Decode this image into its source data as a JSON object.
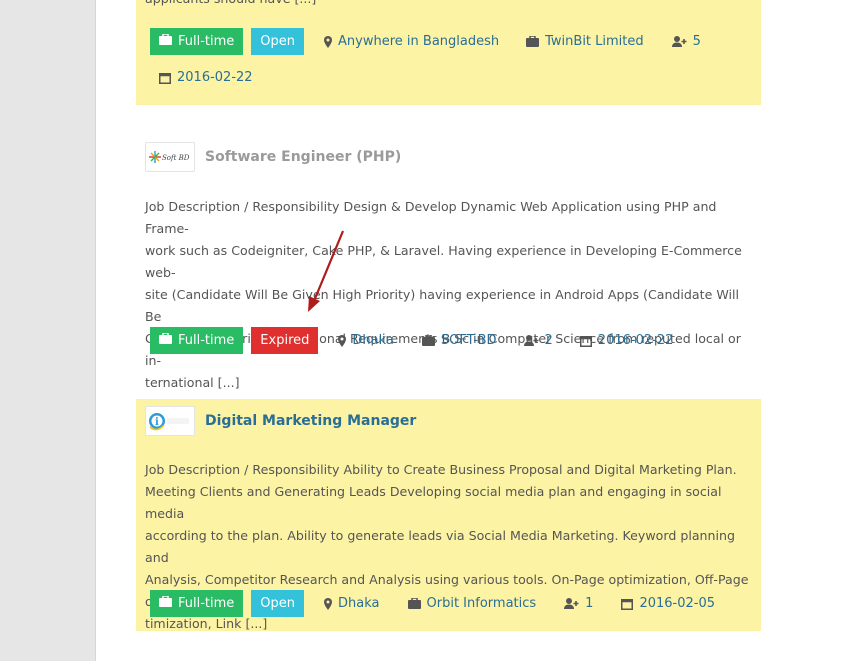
{
  "jobs": [
    {
      "title": "",
      "description": "applicants should have [...]",
      "type_label": "Full-time",
      "status_label": "Open",
      "location": "Anywhere in Bangladesh",
      "company": "TwinBit Limited",
      "applicants": "5",
      "date": "2016-02-22"
    },
    {
      "title": "Software Engineer (PHP)",
      "logo_text": "Soft BD",
      "description_lines": [
        "Job Description / Responsibility Design & Develop Dynamic Web Application using PHP and Frame-",
        "work such as Codeigniter, Cake PHP, & Laravel. Having experience in Developing E-Commerce web-",
        "site (Candidate Will Be Given High Priority) having experience in Android Apps (Candidate Will Be",
        "Given High Priority) Educational Requirements B.Sc in Computer Science from reputed local or in-",
        "ternational [...]"
      ],
      "type_label": "Full-time",
      "status_label": "Expired",
      "location": "Dhaka",
      "company": "SOFT-BD",
      "applicants": "2",
      "date": "2016-02-22"
    },
    {
      "title": "Digital Marketing Manager",
      "logo_text": "i",
      "description_lines": [
        "Job Description / Responsibility Ability to Create Business Proposal and Digital Marketing Plan.",
        "Meeting Clients and Generating Leads Developing social media plan and engaging in social media",
        "according to the plan. Ability to generate leads via Social Media Marketing. Keyword planning and",
        "Analysis, Competitor Research and Analysis using various tools. On-Page optimization, Off-Page op-",
        "timization, Link [...]"
      ],
      "type_label": "Full-time",
      "status_label": "Open",
      "location": "Dhaka",
      "company": "Orbit Informatics",
      "applicants": "1",
      "date": "2016-02-05"
    }
  ],
  "colors": {
    "highlight_bg": "#fcf3a5",
    "fulltime": "#2abb65",
    "open": "#34c2db",
    "expired": "#df2f2f",
    "link": "#2a6e96",
    "annotation_arrow": "#b01c1c"
  }
}
